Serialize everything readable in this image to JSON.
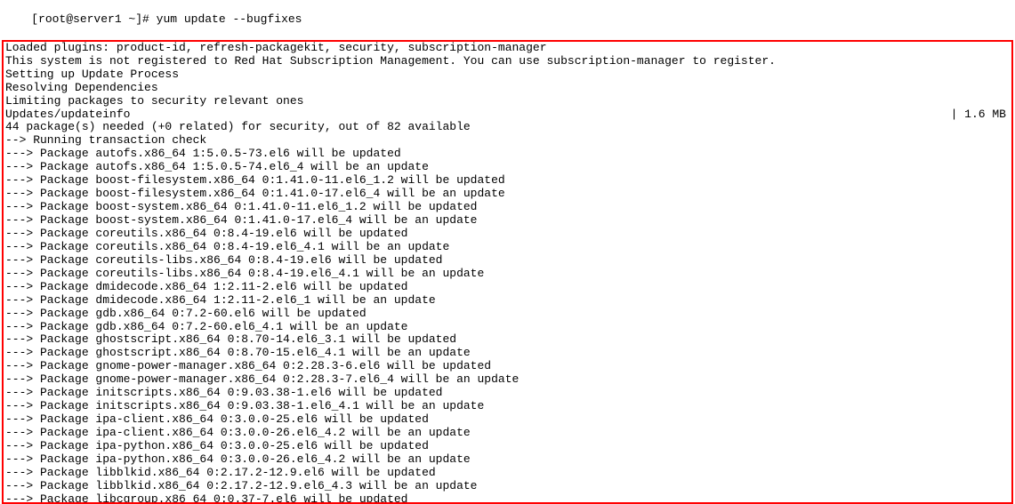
{
  "prompt": {
    "text": "[root@server1 ~]# yum update --bugfixes"
  },
  "lines": [
    {
      "text": "Loaded plugins: product-id, refresh-packagekit, security, subscription-manager"
    },
    {
      "text": "This system is not registered to Red Hat Subscription Management. You can use subscription-manager to register."
    },
    {
      "text": "Setting up Update Process"
    },
    {
      "text": "Resolving Dependencies"
    },
    {
      "text": "Limiting packages to security relevant ones"
    },
    {
      "text": "Updates/updateinfo",
      "right": "| 1.6 MB"
    },
    {
      "text": "44 package(s) needed (+0 related) for security, out of 82 available"
    },
    {
      "text": "--> Running transaction check"
    },
    {
      "text": "---> Package autofs.x86_64 1:5.0.5-73.el6 will be updated"
    },
    {
      "text": "---> Package autofs.x86_64 1:5.0.5-74.el6_4 will be an update"
    },
    {
      "text": "---> Package boost-filesystem.x86_64 0:1.41.0-11.el6_1.2 will be updated"
    },
    {
      "text": "---> Package boost-filesystem.x86_64 0:1.41.0-17.el6_4 will be an update"
    },
    {
      "text": "---> Package boost-system.x86_64 0:1.41.0-11.el6_1.2 will be updated"
    },
    {
      "text": "---> Package boost-system.x86_64 0:1.41.0-17.el6_4 will be an update"
    },
    {
      "text": "---> Package coreutils.x86_64 0:8.4-19.el6 will be updated"
    },
    {
      "text": "---> Package coreutils.x86_64 0:8.4-19.el6_4.1 will be an update"
    },
    {
      "text": "---> Package coreutils-libs.x86_64 0:8.4-19.el6 will be updated"
    },
    {
      "text": "---> Package coreutils-libs.x86_64 0:8.4-19.el6_4.1 will be an update"
    },
    {
      "text": "---> Package dmidecode.x86_64 1:2.11-2.el6 will be updated"
    },
    {
      "text": "---> Package dmidecode.x86_64 1:2.11-2.el6_1 will be an update"
    },
    {
      "text": "---> Package gdb.x86_64 0:7.2-60.el6 will be updated"
    },
    {
      "text": "---> Package gdb.x86_64 0:7.2-60.el6_4.1 will be an update"
    },
    {
      "text": "---> Package ghostscript.x86_64 0:8.70-14.el6_3.1 will be updated"
    },
    {
      "text": "---> Package ghostscript.x86_64 0:8.70-15.el6_4.1 will be an update"
    },
    {
      "text": "---> Package gnome-power-manager.x86_64 0:2.28.3-6.el6 will be updated"
    },
    {
      "text": "---> Package gnome-power-manager.x86_64 0:2.28.3-7.el6_4 will be an update"
    },
    {
      "text": "---> Package initscripts.x86_64 0:9.03.38-1.el6 will be updated"
    },
    {
      "text": "---> Package initscripts.x86_64 0:9.03.38-1.el6_4.1 will be an update"
    },
    {
      "text": "---> Package ipa-client.x86_64 0:3.0.0-25.el6 will be updated"
    },
    {
      "text": "---> Package ipa-client.x86_64 0:3.0.0-26.el6_4.2 will be an update"
    },
    {
      "text": "---> Package ipa-python.x86_64 0:3.0.0-25.el6 will be updated"
    },
    {
      "text": "---> Package ipa-python.x86_64 0:3.0.0-26.el6_4.2 will be an update"
    },
    {
      "text": "---> Package libblkid.x86_64 0:2.17.2-12.9.el6 will be updated"
    },
    {
      "text": "---> Package libblkid.x86_64 0:2.17.2-12.9.el6_4.3 will be an update"
    },
    {
      "text": "---> Package libcgroup.x86_64 0:0.37-7.el6 will be updated"
    }
  ]
}
